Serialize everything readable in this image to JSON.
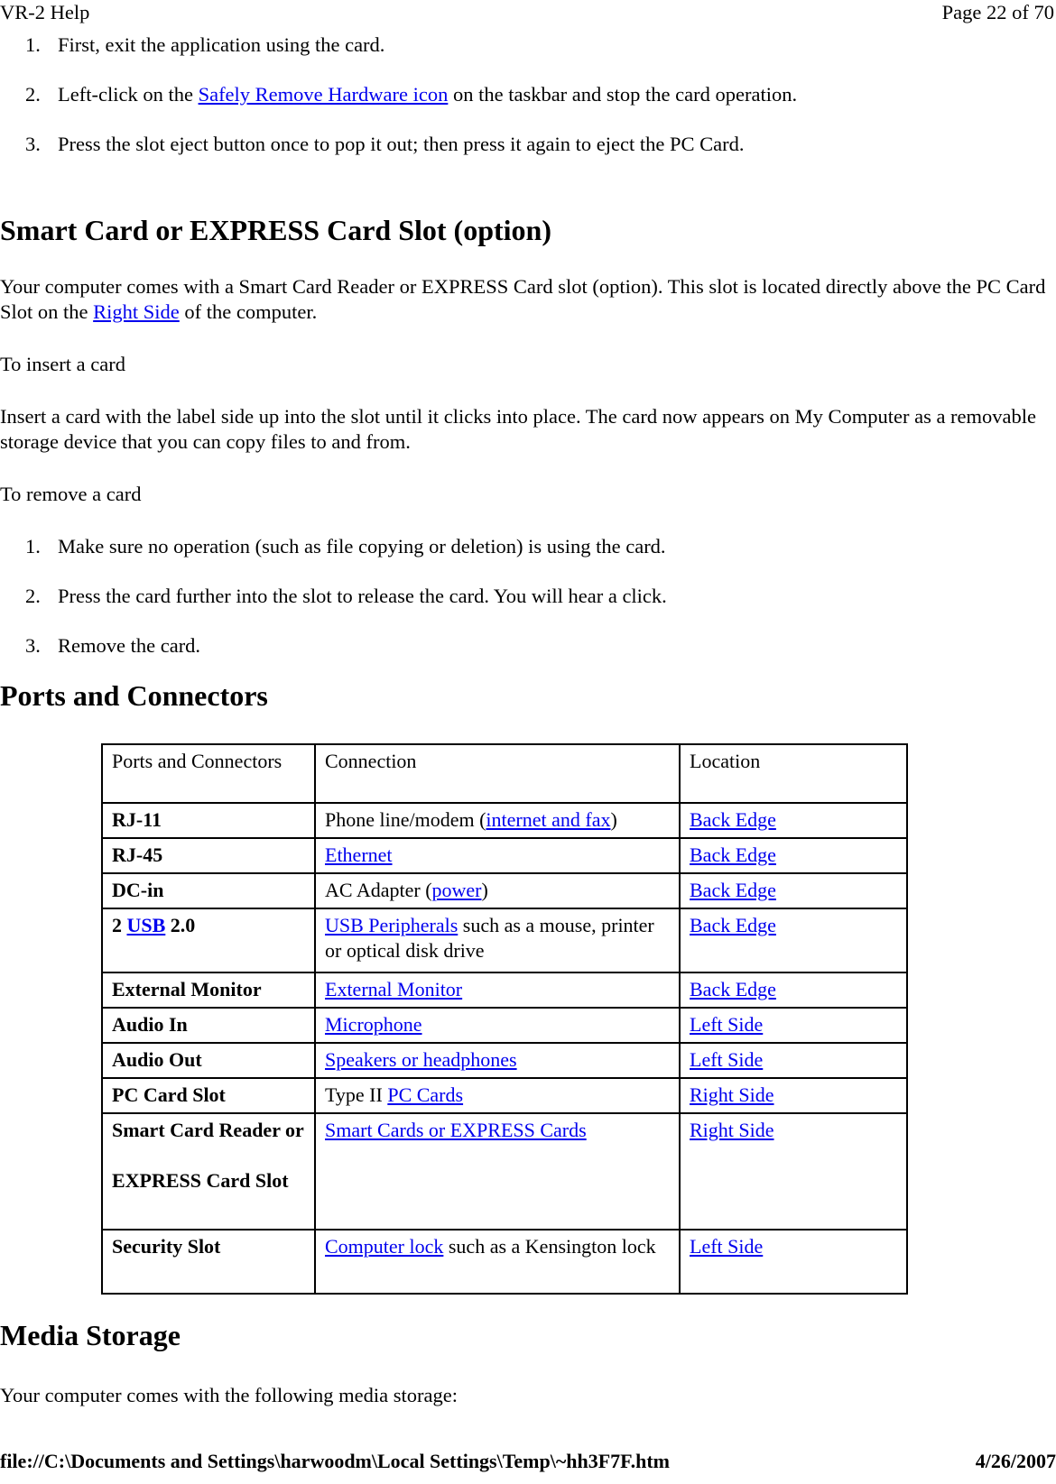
{
  "header": {
    "left": "VR-2 Help",
    "right": "Page 22 of 70"
  },
  "footer": {
    "path": "file://C:\\Documents and Settings\\harwoodm\\Local Settings\\Temp\\~hh3F7F.htm",
    "date": "4/26/2007"
  },
  "colors": {
    "link": "#0000ee",
    "text": "#000000",
    "page_background": "#ffffff",
    "table_border": "#000000"
  },
  "top_steps": [
    {
      "num": "1.",
      "prefix": "First, exit the application using the card.",
      "link": "",
      "suffix": ""
    },
    {
      "num": "2.",
      "prefix": "Left-click on the ",
      "link": "Safely Remove Hardware icon",
      "suffix": " on the taskbar and stop the card operation."
    },
    {
      "num": "3.",
      "prefix": "Press the slot eject button once to pop it out; then press it again to eject the PC Card.",
      "link": "",
      "suffix": ""
    }
  ],
  "section_smartcard": {
    "heading": "Smart Card or EXPRESS Card Slot (option)",
    "intro_prefix": "Your computer comes with a Smart Card Reader or EXPRESS Card slot (option). This slot is located directly above the PC Card Slot on the ",
    "intro_link": "Right Side",
    "intro_suffix": " of the computer.",
    "insert_label": "To insert a card",
    "insert_body": "Insert a card with the label side up into the slot until it clicks into place. The card now appears on My Computer as a removable storage device that you can copy files to and from.",
    "remove_label": "To remove a card",
    "remove_steps": [
      {
        "num": "1.",
        "text": "Make sure no operation (such as file copying or deletion) is using the card."
      },
      {
        "num": "2.",
        "text": "Press the card further into the slot to release the card. You will hear a click."
      },
      {
        "num": "3.",
        "text": "Remove the card."
      }
    ]
  },
  "section_ports": {
    "heading": "Ports and Connectors",
    "table": {
      "headers": [
        "Ports and Connectors",
        "Connection",
        "Location"
      ],
      "rows": [
        {
          "port_pre": "RJ-11",
          "port_link": "",
          "port_post": "",
          "conn_pre": "Phone line/modem (",
          "conn_link": "internet and fax",
          "conn_post": ")",
          "location": "Back Edge"
        },
        {
          "port_pre": "RJ-45",
          "port_link": "",
          "port_post": "",
          "conn_pre": "",
          "conn_link": "Ethernet",
          "conn_post": "",
          "location": "Back Edge"
        },
        {
          "port_pre": "DC-in",
          "port_link": "",
          "port_post": "",
          "conn_pre": "AC Adapter (",
          "conn_link": "power",
          "conn_post": ")",
          "location": "Back Edge"
        },
        {
          "port_pre": "2 ",
          "port_link": "USB",
          "port_post": " 2.0",
          "conn_pre": "",
          "conn_link": "USB Peripherals",
          "conn_post": " such as a mouse, printer or optical disk drive",
          "location": "Back Edge"
        },
        {
          "port_pre": "External Monitor",
          "port_link": "",
          "port_post": "",
          "conn_pre": "",
          "conn_link": "External Monitor",
          "conn_post": "",
          "location": "Back Edge"
        },
        {
          "port_pre": "Audio In",
          "port_link": "",
          "port_post": "",
          "conn_pre": "",
          "conn_link": "Microphone",
          "conn_post": "",
          "location": "Left Side"
        },
        {
          "port_pre": "Audio Out",
          "port_link": "",
          "port_post": "",
          "conn_pre": "",
          "conn_link": "Speakers or headphones",
          "conn_post": "",
          "location": "Left Side"
        },
        {
          "port_pre": "PC Card Slot",
          "port_link": "",
          "port_post": "",
          "conn_pre": "Type II ",
          "conn_link": "PC Cards",
          "conn_post": "",
          "location": "Right Side"
        },
        {
          "port_pre": "Smart Card Reader or",
          "port_link": "",
          "port_post": "EXPRESS Card Slot",
          "conn_pre": "",
          "conn_link": "Smart Cards or EXPRESS Cards",
          "conn_post": "",
          "location": "Right Side"
        },
        {
          "port_pre": "Security Slot",
          "port_link": "",
          "port_post": "",
          "conn_pre": "",
          "conn_link": "Computer lock",
          "conn_post": " such as a Kensington lock",
          "location": "Left Side"
        }
      ]
    }
  },
  "section_media": {
    "heading": "Media Storage",
    "body": "Your computer comes with the following media storage:"
  }
}
